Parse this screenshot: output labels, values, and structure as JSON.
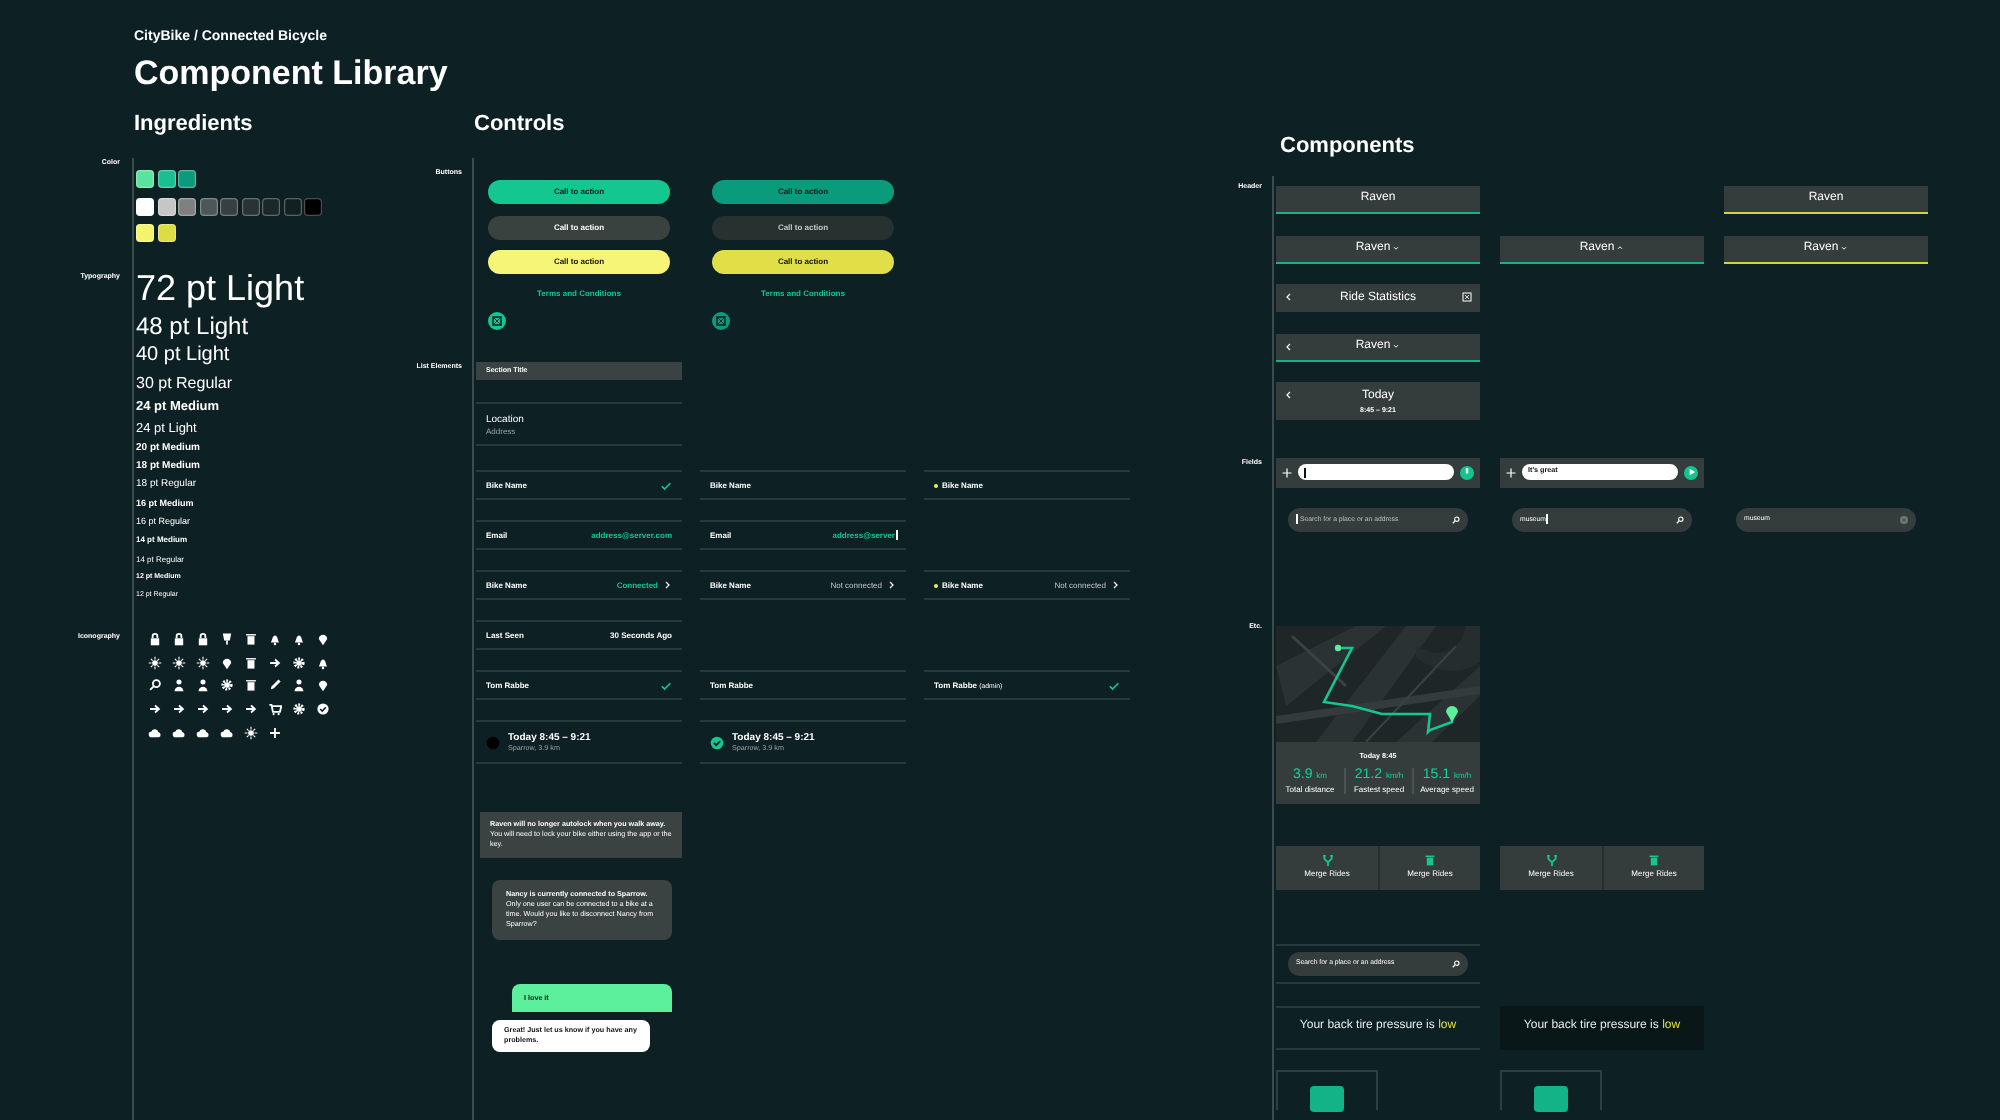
{
  "header": {
    "subtitle": "CityBike / Connected Bicycle",
    "title": "Component Library"
  },
  "ingredients": {
    "title": "Ingredients",
    "labels": [
      "Color",
      "Typography",
      "Iconography"
    ],
    "swatch_rows": [
      {
        "swatches": [
          {
            "color": "#5ae39e"
          },
          {
            "color": "#17c08e"
          },
          {
            "color": "#0c9a7e"
          }
        ]
      },
      {
        "swatches": [
          {
            "color": "#ffffff"
          },
          {
            "color": "#c6c6c6"
          },
          {
            "color": "#808080"
          },
          {
            "color": "#4e5757"
          },
          {
            "color": "#37403f"
          },
          {
            "color": "#283332"
          },
          {
            "color": "#1c2828"
          },
          {
            "color": "#12201f"
          },
          {
            "color": "#000000"
          }
        ]
      },
      {
        "swatches": [
          {
            "color": "#f4f46c"
          },
          {
            "color": "#dcdc44"
          }
        ]
      }
    ],
    "type_samples": [
      "72 pt Light",
      "48 pt Light",
      "40 pt Light",
      "30 pt Regular",
      "24 pt Medium",
      "24 pt Light",
      "20 pt Medium",
      "18 pt Medium",
      "18 pt Regular",
      "16 pt Medium",
      "16 pt Regular",
      "14 pt Medium",
      "14 pt Regular",
      "12 pt Medium",
      "12 pt Regular"
    ]
  },
  "controls": {
    "title": "Controls",
    "labels": [
      "Buttons",
      "List Elements"
    ],
    "button_columns": [
      {
        "pressed": false,
        "buttons": [
          {
            "kind": "primary",
            "label": "Call to action"
          },
          {
            "kind": "secondary",
            "label": "Call to action"
          },
          {
            "kind": "highlight",
            "label": "Call to action"
          },
          {
            "kind": "link",
            "label": "Terms and Conditions"
          },
          {
            "kind": "icon"
          }
        ]
      },
      {
        "pressed": true,
        "buttons": [
          {
            "kind": "primary",
            "label": "Call to action"
          },
          {
            "kind": "secondary",
            "label": "Call to action"
          },
          {
            "kind": "highlight",
            "label": "Call to action"
          },
          {
            "kind": "link",
            "label": "Terms and Conditions"
          },
          {
            "kind": "icon"
          }
        ]
      }
    ],
    "section_title": "Section Title",
    "location": {
      "title": "Location",
      "subtitle": "Address"
    },
    "list_rows": [
      {
        "kind": "check",
        "cells": [
          {
            "label": "Bike Name",
            "checked": true,
            "flagged": false
          },
          {
            "label": "Bike Name",
            "checked": false,
            "flagged": false
          },
          {
            "label": "Bike Name",
            "checked": false,
            "flagged": true
          }
        ]
      },
      {
        "kind": "field",
        "cells": [
          {
            "label": "Email",
            "value": "address@server.com",
            "cursor": false
          },
          {
            "label": "Email",
            "value": "address@server",
            "cursor": true
          }
        ]
      },
      {
        "kind": "status",
        "cells": [
          {
            "label": "Bike Name",
            "value": "Connected",
            "connected": true,
            "flagged": false
          },
          {
            "label": "Bike Name",
            "value": "Not connected",
            "connected": false,
            "flagged": false
          },
          {
            "label": "Bike Name",
            "value": "Not connected",
            "connected": false,
            "flagged": true
          }
        ]
      },
      {
        "kind": "info",
        "cells": [
          {
            "label": "Last Seen",
            "value": "30 Seconds Ago"
          }
        ]
      },
      {
        "kind": "check",
        "cells": [
          {
            "label": "Tom Rabbe",
            "checked": true,
            "flagged": false
          },
          {
            "label": "Tom Rabbe",
            "checked": false,
            "flagged": false
          },
          {
            "label": "Tom Rabbe",
            "note": "(admin)",
            "checked": true,
            "flagged": false
          }
        ]
      },
      {
        "kind": "ride",
        "cells": [
          {
            "title": "Today 8:45 – 9:21",
            "subtitle": "Sparrow, 3.9 km",
            "done": false
          },
          {
            "title": "Today 8:45 – 9:21",
            "subtitle": "Sparrow, 3.9 km",
            "done": true
          }
        ]
      }
    ],
    "notice": "**Raven will no longer autolock when you walk away.** You will need to lock your bike either using the app or the key.",
    "dialog": "**Nancy is currently connected to Sparrow.** Only one user can be connected to a bike at a time. Would you like to disconnect Nancy from Sparrow?",
    "chat": [
      {
        "kind": "user",
        "text": "I love it"
      },
      {
        "kind": "bot",
        "text": "Great! Just let us know if you have any problems."
      }
    ]
  },
  "components": {
    "title": "Components",
    "labels": [
      "Header",
      "Fields",
      "Etc."
    ],
    "header_rows": [
      [
        {
          "kind": "tab",
          "title": "Raven",
          "color": "#12b487"
        },
        {
          "kind": "blank"
        },
        {
          "kind": "tab",
          "title": "Raven",
          "color": "#d4d23e"
        }
      ],
      [
        {
          "kind": "dropdown",
          "title": "Raven",
          "expanded": false,
          "color": "#12b487"
        },
        {
          "kind": "dropdown",
          "title": "Raven",
          "expanded": true,
          "color": "#12b487"
        },
        {
          "kind": "dropdown",
          "title": "Raven",
          "expanded": false,
          "color": "#d4d23e"
        }
      ],
      [
        {
          "kind": "nav",
          "title": "Ride Statistics"
        }
      ],
      [
        {
          "kind": "nav_dropdown",
          "title": "Raven",
          "expanded": false,
          "color": "#12b487"
        }
      ],
      [
        {
          "kind": "nav_detail",
          "title": "Today",
          "subtitle": "8:45 – 9:21"
        }
      ]
    ],
    "compose_bars": [
      {
        "kind": "voice",
        "cursor": true
      },
      {
        "kind": "send",
        "text": "It's great",
        "cursor": false
      }
    ],
    "search_fields": [
      {
        "kind": "empty",
        "placeholder": "Search for a place or an address",
        "cursor": true
      },
      {
        "kind": "typing",
        "value": "museum",
        "cursor": true
      },
      {
        "kind": "filled",
        "value": "museum",
        "cursor": false
      }
    ],
    "ride_card": {
      "title": "Today 8:45",
      "stats": [
        {
          "value": "3.9",
          "unit": "km",
          "label": "Total distance"
        },
        {
          "value": "21.2",
          "unit": "km/h",
          "label": "Fastest speed"
        },
        {
          "value": "15.1",
          "unit": "km/h",
          "label": "Average speed"
        }
      ]
    },
    "action_bars": [
      {
        "actions": [
          {
            "kind": "merge",
            "label": "Merge Rides"
          },
          {
            "kind": "delete",
            "label": "Merge Rides"
          }
        ]
      },
      {
        "actions": [
          {
            "kind": "merge",
            "label": "Merge Rides"
          },
          {
            "kind": "delete",
            "label": "Merge Rides"
          }
        ]
      }
    ],
    "list_search": {
      "placeholder": "Search for a place or an address"
    },
    "alerts": [
      {
        "kind": "plain",
        "text": "Your back tire pressure is *low*"
      },
      {
        "kind": "dark",
        "text": "Your back tire pressure is *low*"
      }
    ]
  }
}
